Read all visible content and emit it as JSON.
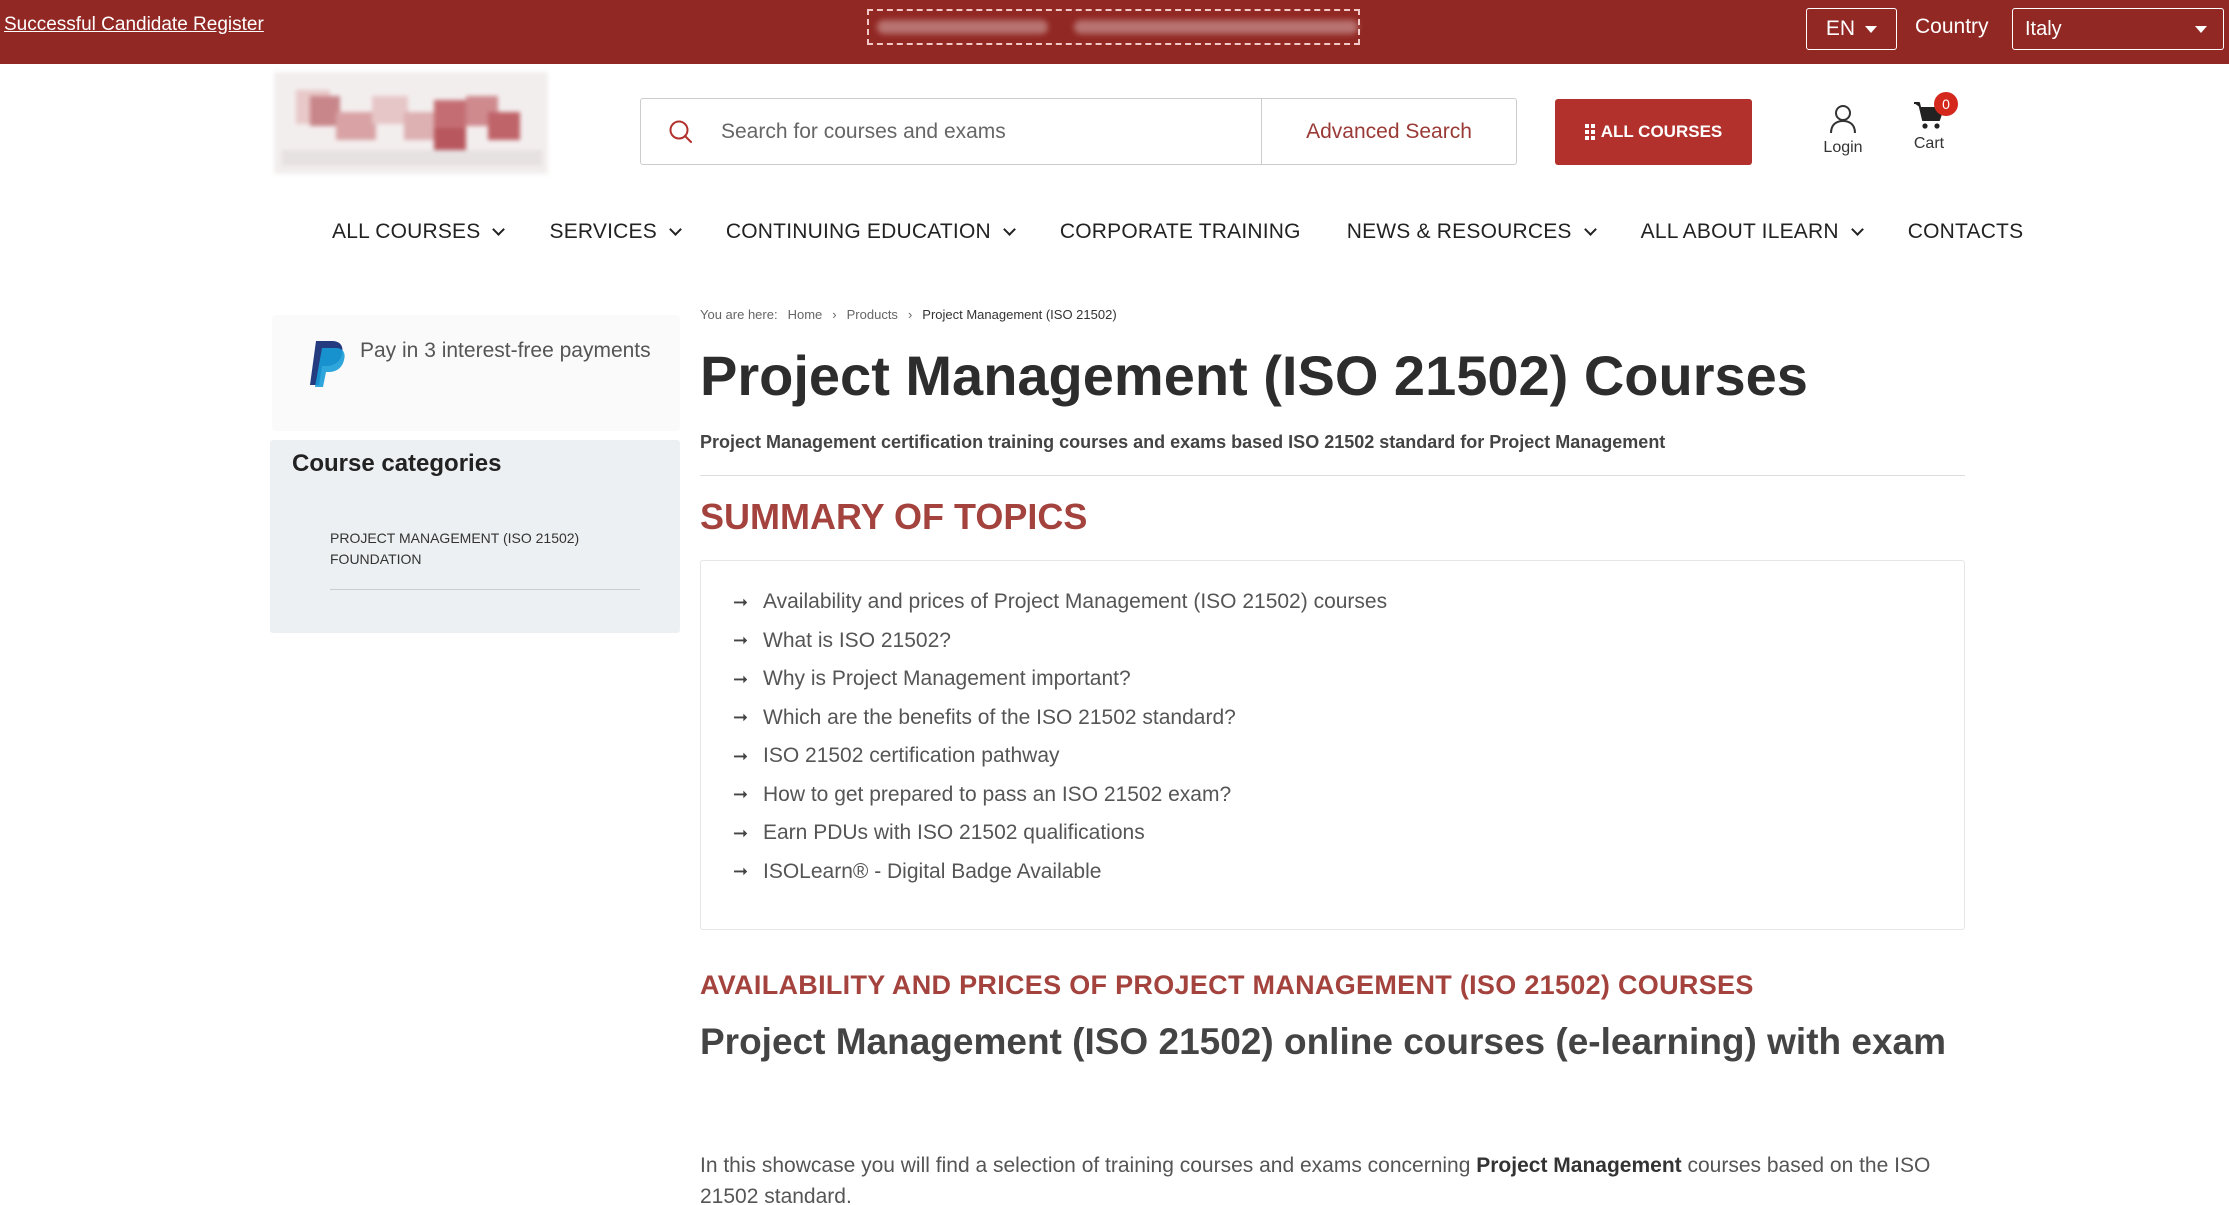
{
  "topbar": {
    "register_link": "Successful Candidate Register",
    "language": "EN",
    "country_label": "Country",
    "country_value": "Italy"
  },
  "header": {
    "search_placeholder": "Search for courses and exams",
    "advanced_search": "Advanced Search",
    "all_courses_button": "ALL COURSES",
    "login_label": "Login",
    "cart_label": "Cart",
    "cart_count": "0"
  },
  "nav": {
    "items": [
      {
        "label": "ALL COURSES"
      },
      {
        "label": "SERVICES"
      },
      {
        "label": "CONTINUING EDUCATION"
      },
      {
        "label": "CORPORATE TRAINING"
      },
      {
        "label": "NEWS & RESOURCES"
      },
      {
        "label": "ALL ABOUT ILEARN"
      },
      {
        "label": "CONTACTS"
      }
    ]
  },
  "sidebar": {
    "paypal_text": "Pay in 3 interest-free payments",
    "categories_title": "Course categories",
    "categories": [
      {
        "label": "PROJECT MANAGEMENT (ISO 21502) FOUNDATION"
      }
    ]
  },
  "breadcrumb": {
    "prefix": "You are here:",
    "items": [
      "Home",
      "Products",
      "Project Management (ISO 21502)"
    ]
  },
  "main": {
    "title": "Project Management (ISO 21502) Courses",
    "subtitle": "Project Management certification training courses and exams based ISO 21502 standard for Project Management",
    "summary_title": "SUMMARY OF TOPICS",
    "topics": [
      "Availability and prices of Project Management (ISO 21502) courses",
      "What is ISO 21502?",
      "Why is Project Management important?",
      "Which are the benefits of the ISO 21502 standard?",
      "ISO 21502 certification pathway",
      "How to get prepared to pass an ISO 21502 exam?",
      "Earn PDUs with ISO 21502 qualifications",
      "ISOLearn® - Digital Badge Available"
    ],
    "availability_heading": "AVAILABILITY AND PRICES OF PROJECT MANAGEMENT (ISO 21502) COURSES",
    "online_heading": "Project Management (ISO 21502) online courses (e-learning) with exam",
    "paragraph_start": "In this showcase you will find a selection of training courses and exams concerning ",
    "paragraph_bold": "Project Management",
    "paragraph_end": " courses based on the ISO 21502 standard."
  },
  "colors": {
    "topbar": "#922824",
    "accent": "#b2312c",
    "heading_red": "#a4433e"
  }
}
